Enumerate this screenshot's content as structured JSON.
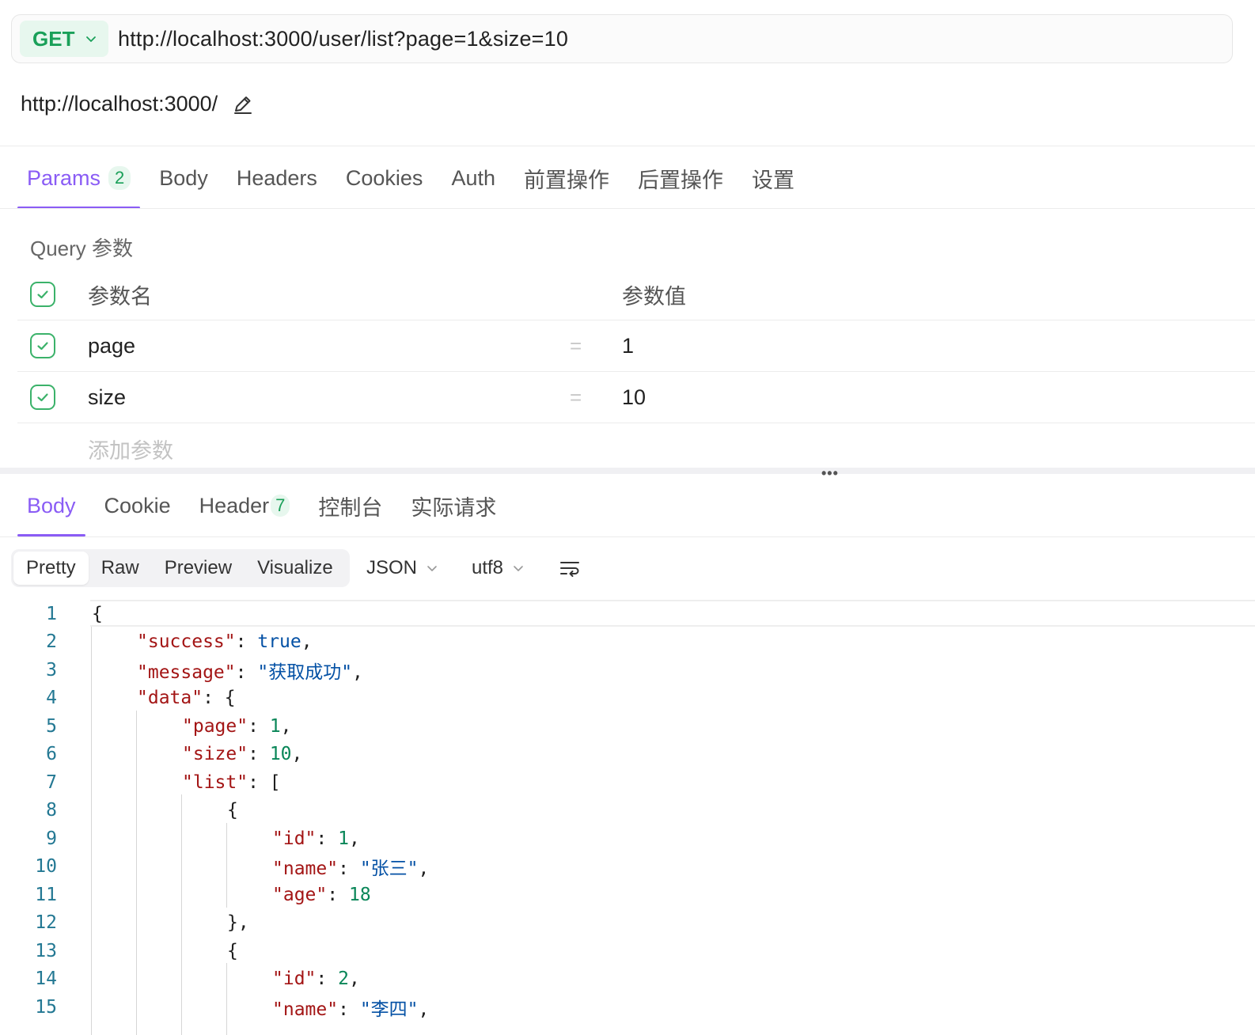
{
  "request": {
    "method": "GET",
    "url": "http://localhost:3000/user/list?page=1&size=10",
    "base_url": "http://localhost:3000/"
  },
  "request_tabs": [
    {
      "label": "Params",
      "badge": "2",
      "active": true
    },
    {
      "label": "Body"
    },
    {
      "label": "Headers"
    },
    {
      "label": "Cookies"
    },
    {
      "label": "Auth"
    },
    {
      "label": "前置操作"
    },
    {
      "label": "后置操作"
    },
    {
      "label": "设置"
    }
  ],
  "params": {
    "section_label": "Query 参数",
    "header_name": "参数名",
    "header_value": "参数值",
    "rows": [
      {
        "name": "page",
        "value": "1"
      },
      {
        "name": "size",
        "value": "10"
      }
    ],
    "add_placeholder": "添加参数",
    "equals": "="
  },
  "response_tabs": [
    {
      "label": "Body",
      "active": true
    },
    {
      "label": "Cookie"
    },
    {
      "label": "Header",
      "badge": "7"
    },
    {
      "label": "控制台"
    },
    {
      "label": "实际请求"
    }
  ],
  "view_modes": [
    "Pretty",
    "Raw",
    "Preview",
    "Visualize"
  ],
  "format_select": "JSON",
  "encoding_select": "utf8",
  "code_lines": [
    {
      "n": "1",
      "t": "{"
    },
    {
      "n": "2",
      "t": "\"success\": true,"
    },
    {
      "n": "3",
      "t": "\"message\": \"获取成功\","
    },
    {
      "n": "4",
      "t": "\"data\": {"
    },
    {
      "n": "5",
      "t": "\"page\": 1,"
    },
    {
      "n": "6",
      "t": "\"size\": 10,"
    },
    {
      "n": "7",
      "t": "\"list\": ["
    },
    {
      "n": "8",
      "t": "{"
    },
    {
      "n": "9",
      "t": "\"id\": 1,"
    },
    {
      "n": "10",
      "t": "\"name\": \"张三\","
    },
    {
      "n": "11",
      "t": "\"age\": 18"
    },
    {
      "n": "12",
      "t": "},"
    },
    {
      "n": "13",
      "t": "{"
    },
    {
      "n": "14",
      "t": "\"id\": 2,"
    },
    {
      "n": "15",
      "t": "\"name\": \"李四\","
    }
  ],
  "colors": {
    "accent": "#8a5cf5",
    "method_green": "#1aa059",
    "json_key": "#a31515",
    "json_string": "#0451a5",
    "json_number": "#098658"
  }
}
